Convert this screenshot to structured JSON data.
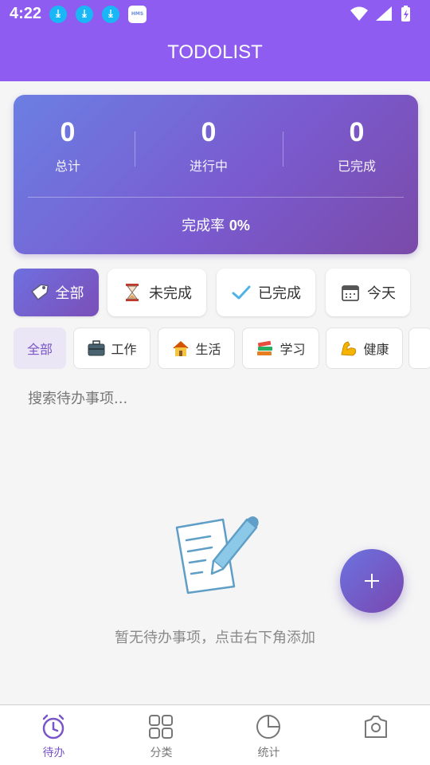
{
  "status_bar": {
    "time": "4:22",
    "icons": [
      "download-icon",
      "download-icon",
      "download-icon",
      "hms-icon",
      "wifi-icon",
      "signal-icon",
      "battery-icon"
    ],
    "hms_label": "HMS"
  },
  "header": {
    "title": "TODOLIST"
  },
  "stats": {
    "total": {
      "value": "0",
      "label": "总计"
    },
    "in_progress": {
      "value": "0",
      "label": "进行中"
    },
    "completed": {
      "value": "0",
      "label": "已完成"
    },
    "rate_label": "完成率",
    "rate_value": "0%"
  },
  "filters": [
    {
      "label": "全部",
      "icon": "tag-icon",
      "active": true
    },
    {
      "label": "未完成",
      "icon": "hourglass-icon",
      "active": false
    },
    {
      "label": "已完成",
      "icon": "checkmark-icon",
      "active": false
    },
    {
      "label": "今天",
      "icon": "calendar-icon",
      "active": false
    }
  ],
  "categories": [
    {
      "label": "全部",
      "active": true
    },
    {
      "label": "工作",
      "icon": "briefcase-icon"
    },
    {
      "label": "生活",
      "icon": "house-icon"
    },
    {
      "label": "学习",
      "icon": "books-icon"
    },
    {
      "label": "健康",
      "icon": "flexed-biceps-icon"
    }
  ],
  "search": {
    "placeholder": "搜索待办事项..."
  },
  "empty_state": {
    "icon": "memo-pencil-icon",
    "text": "暂无待办事项，点击右下角添加"
  },
  "fab": {
    "icon": "plus-icon"
  },
  "bottom_nav": [
    {
      "label": "待办",
      "icon": "alarm-clock-icon",
      "active": true
    },
    {
      "label": "分类",
      "icon": "grid-icon",
      "active": false
    },
    {
      "label": "统计",
      "icon": "pie-chart-icon",
      "active": false
    },
    {
      "label": "",
      "icon": "settings-icon",
      "active": false
    }
  ],
  "colors": {
    "primary": "#8e5cf0",
    "accent": "#7a55c8",
    "background": "#f5f5f5"
  }
}
